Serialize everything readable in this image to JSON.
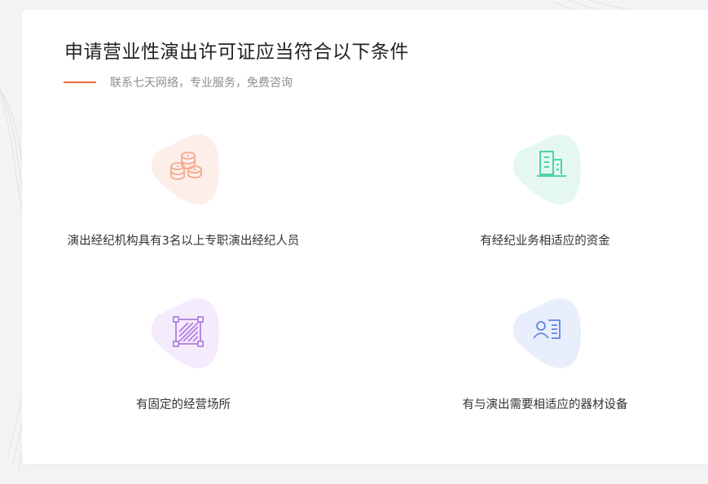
{
  "header": {
    "title": "申请营业性演出许可证应当符合以下条件",
    "subtitle": "联系七天网络，专业服务，免费咨询"
  },
  "colors": {
    "accent": "#f26b3a",
    "coins": "#f5a98f",
    "building": "#3ccf9b",
    "hatch": "#b07ee0",
    "contact": "#5f86e6"
  },
  "features": [
    {
      "icon": "coins-icon",
      "label": "演出经纪机构具有3名以上专职演出经纪人员"
    },
    {
      "icon": "building-icon",
      "label": "有经纪业务相适应的资金"
    },
    {
      "icon": "hatched-square-icon",
      "label": "有固定的经营场所"
    },
    {
      "icon": "contact-card-icon",
      "label": "有与演出需要相适应的器材设备"
    }
  ]
}
